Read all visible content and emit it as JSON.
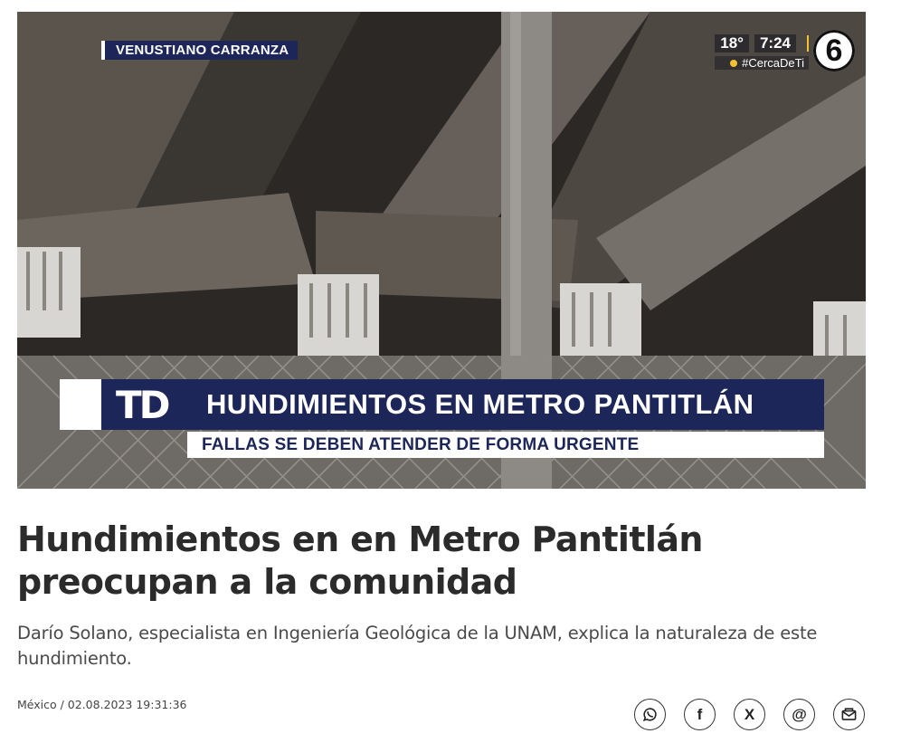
{
  "hero": {
    "location_tag": "VENUSTIANO CARRANZA",
    "temperature": "18°",
    "time": "7:24",
    "hashtag": "#CercaDeTi",
    "channel_number": "6",
    "show_logo": "TD",
    "lower_third_headline": "HUNDIMIENTOS EN METRO PANTITLÁN",
    "lower_third_subheadline": "FALLAS SE DEBEN ATENDER DE FORMA URGENTE"
  },
  "article": {
    "headline": "Hundimientos en en Metro Pantitlán preocupan a la comunidad",
    "dek": "Darío Solano, especialista en Ingeniería Geológica de la UNAM, explica la naturaleza de este hundimiento.",
    "meta": "México / 02.08.2023 19:31:36"
  },
  "share": [
    {
      "name": "whatsapp-icon"
    },
    {
      "name": "facebook-icon",
      "glyph": "f"
    },
    {
      "name": "x-icon",
      "glyph": "X"
    },
    {
      "name": "threads-icon",
      "glyph": "@"
    },
    {
      "name": "email-icon"
    }
  ],
  "colors": {
    "navy": "#1d2658",
    "accent_yellow": "#f2c230",
    "text": "#2b2b2b"
  }
}
